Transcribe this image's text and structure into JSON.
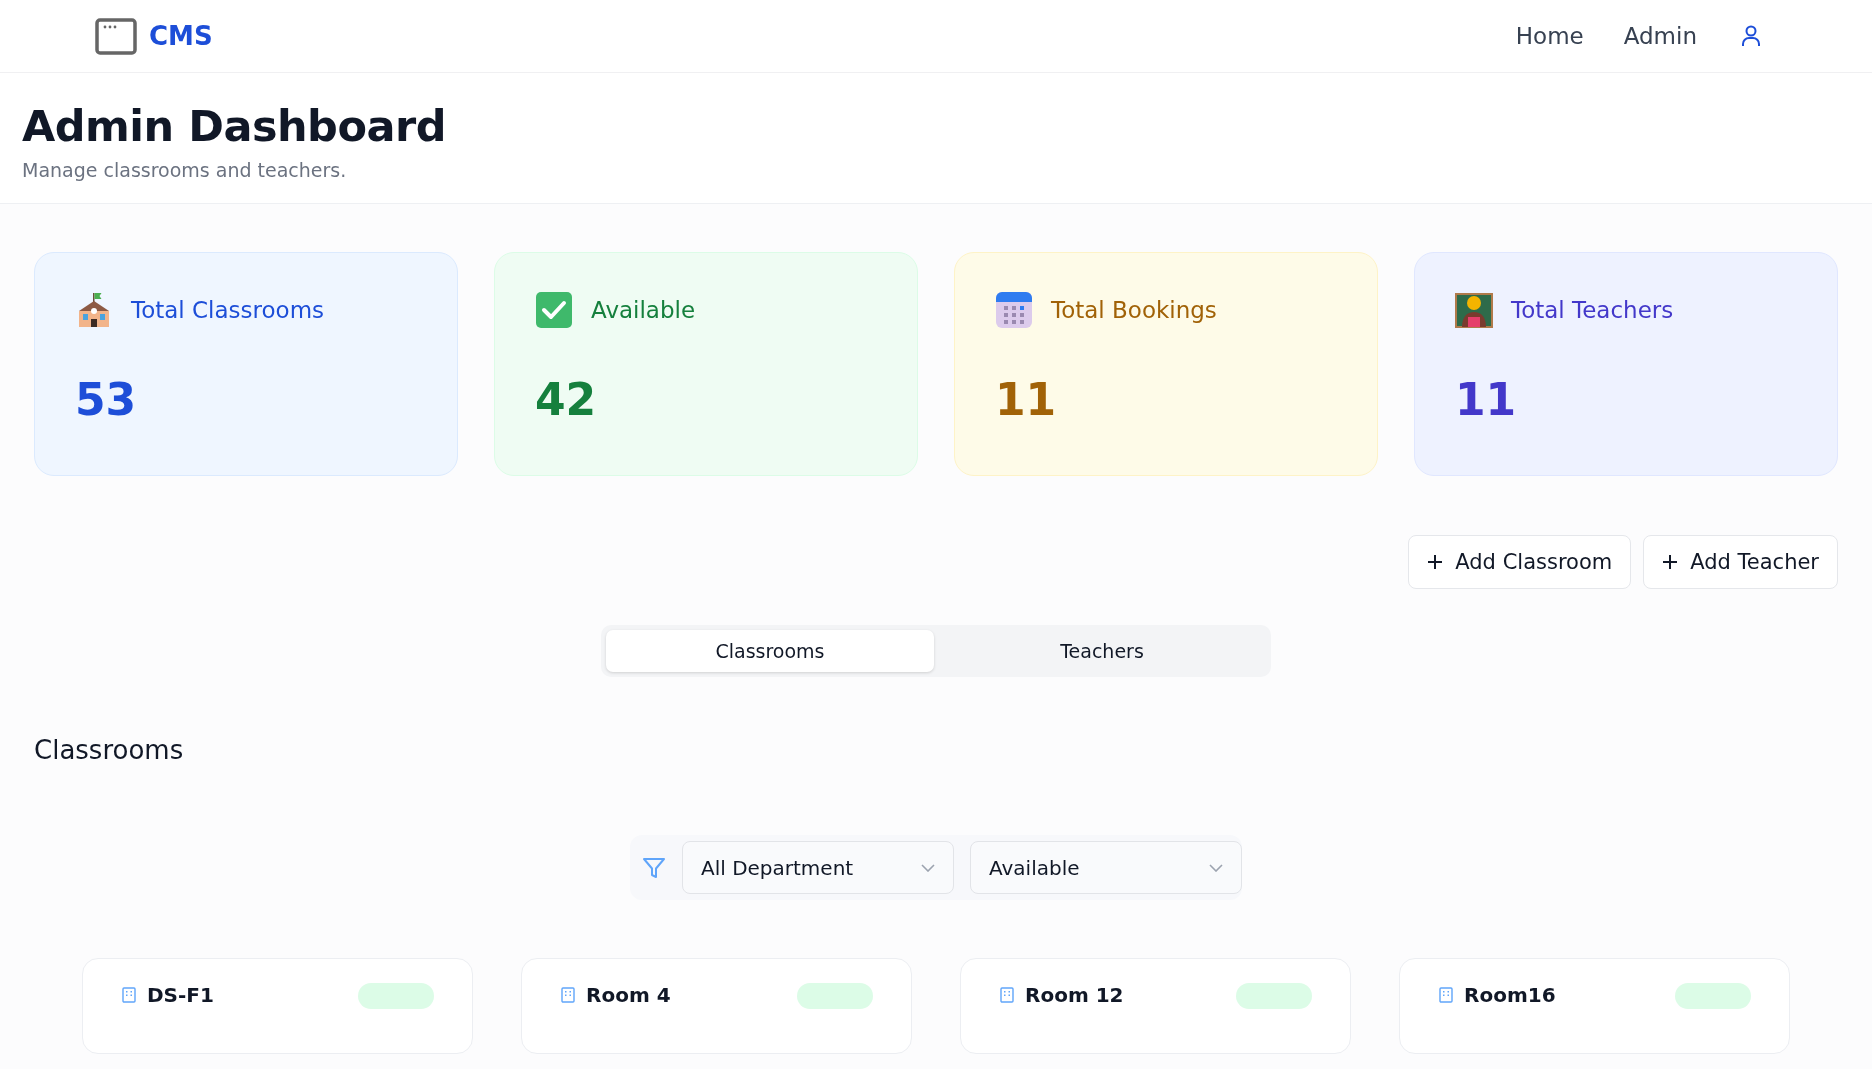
{
  "brand": "CMS",
  "nav": [
    {
      "label": "Home",
      "selected": false
    },
    {
      "label": "Admin",
      "selected": false
    }
  ],
  "page": {
    "title": "Admin Dashboard",
    "subtitle": "Manage classrooms and teachers."
  },
  "stats": [
    {
      "kind": "school",
      "label": "Total Classrooms",
      "value": "53",
      "color": "#1d4ed8"
    },
    {
      "kind": "check",
      "label": "Available",
      "value": "42",
      "color": "#15803d"
    },
    {
      "kind": "calendar",
      "label": "Total Bookings",
      "value": "11",
      "color": "#a16207"
    },
    {
      "kind": "teacher",
      "label": "Total Teachers",
      "value": "11",
      "color": "#4338ca"
    }
  ],
  "actions": [
    "Add Classroom",
    "Add Teacher"
  ],
  "tabs": [
    {
      "label": "Classrooms",
      "selected": true
    },
    {
      "label": "Teachers",
      "selected": false
    }
  ],
  "section_title": "Classrooms",
  "filters": [
    {
      "value": "All Department"
    },
    {
      "value": "Available"
    }
  ],
  "rooms": [
    {
      "name": "DS-F1"
    },
    {
      "name": "Room 4"
    },
    {
      "name": "Room 12"
    },
    {
      "name": "Room16"
    }
  ]
}
